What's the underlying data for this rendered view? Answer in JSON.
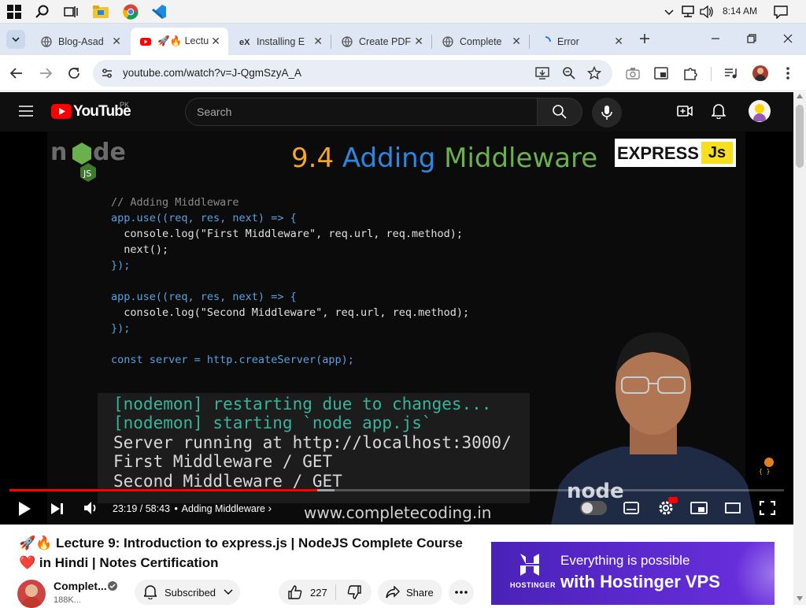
{
  "taskbar": {
    "time": "8:14 AM",
    "icons": [
      "windows-start-icon",
      "search-icon",
      "task-view-icon",
      "file-explorer-icon",
      "chrome-icon",
      "vscode-icon"
    ]
  },
  "browser": {
    "tabs": [
      {
        "title": "Blog-Asad",
        "icon": "globe-icon",
        "active": false
      },
      {
        "title": "🚀🔥 Lectu",
        "icon": "youtube-icon",
        "active": true
      },
      {
        "title": "Installing E",
        "icon": "ex-icon",
        "active": false
      },
      {
        "title": "Create PDF",
        "icon": "globe-icon",
        "active": false
      },
      {
        "title": "Complete",
        "icon": "globe-icon",
        "active": false
      },
      {
        "title": "Error",
        "icon": "loading-icon",
        "active": false
      }
    ],
    "url": "youtube.com/watch?v=J-QgmSzyA_A"
  },
  "youtube": {
    "logo_text": "YouTube",
    "region": "PK",
    "search_placeholder": "Search"
  },
  "video": {
    "slide_title_num": "9.4",
    "slide_title_w1": "Adding",
    "slide_title_w2": "Middleware",
    "badge_express": "EXPRESS",
    "badge_js": "Js",
    "code_lines": [
      "// Adding Middleware",
      "app.use((req, res, next) => {",
      "  console.log(\"First Middleware\", req.url, req.method);",
      "  next();",
      "});",
      "",
      "app.use((req, res, next) => {",
      "  console.log(\"Second Middleware\", req.url, req.method);",
      "});",
      "",
      "const server = http.createServer(app);"
    ],
    "terminal_lines": [
      {
        "text": "[nodemon] restarting due to changes...",
        "color": "green"
      },
      {
        "text": "[nodemon] starting `node app.js`",
        "color": "green"
      },
      {
        "text": "Server running at http://localhost:3000/",
        "color": "white"
      },
      {
        "text": "First Middleware / GET",
        "color": "white"
      },
      {
        "text": "Second Middleware / GET",
        "color": "white"
      }
    ],
    "watermark": "www.completecoding.in",
    "current_time": "23:19",
    "duration": "58:43",
    "time_separator": " / ",
    "chapter": "Adding Middleware",
    "progress_fraction": 0.397,
    "buffered_fraction": 0.42
  },
  "below_video": {
    "title": "🚀🔥 Lecture 9: Introduction to express.js | NodeJS Complete Course ❤️ in Hindi | Notes Certification",
    "channel_name": "Complet...",
    "channel_subs": "188K...",
    "subscribe_label": "Subscribed",
    "likes": "227",
    "share_label": "Share"
  },
  "ad": {
    "line1": "Everything is possible",
    "line2": "with Hostinger VPS",
    "brand": "HOSTINGER"
  }
}
